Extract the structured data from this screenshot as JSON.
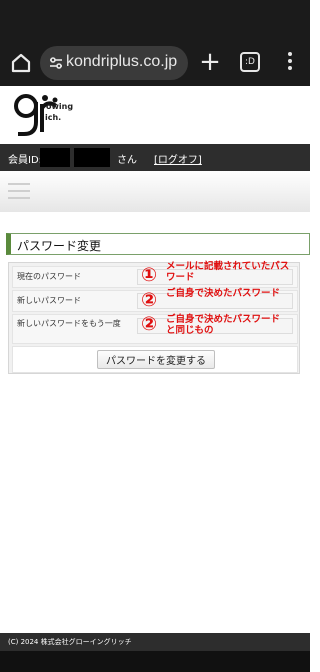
{
  "browser": {
    "url": "kondriplus.co.jp",
    "tabs_count": ":D",
    "icons": [
      "home-icon",
      "site-settings-icon",
      "new-tab-icon",
      "tabs-icon",
      "more-menu-icon"
    ]
  },
  "site": {
    "logo_lines": [
      "owing",
      "ich."
    ]
  },
  "member_bar": {
    "label": "会員ID:",
    "suffix": "さん",
    "logoff": "[ログオフ]"
  },
  "section": {
    "title": "パスワード変更"
  },
  "form": {
    "rows": [
      {
        "label": "現在のパスワード",
        "value": ""
      },
      {
        "label": "新しいパスワード",
        "value": ""
      },
      {
        "label": "新しいパスワードをもう一度",
        "value": ""
      }
    ],
    "submit_label": "パスワードを変更する"
  },
  "annotations": [
    {
      "number": "①",
      "text": "メールに記載されていたパスワード"
    },
    {
      "number": "②",
      "text": "ご自身で決めたパスワード"
    },
    {
      "number": "②",
      "text": "ご自身で決めたパスワードと同じもの"
    }
  ],
  "footer": {
    "copyright": "(C) 2024 株式会社グローイングリッチ"
  },
  "colors": {
    "annotation": "#e01010",
    "heading_accent": "#5a8a3c",
    "dark_bar": "#2d2d2d"
  }
}
